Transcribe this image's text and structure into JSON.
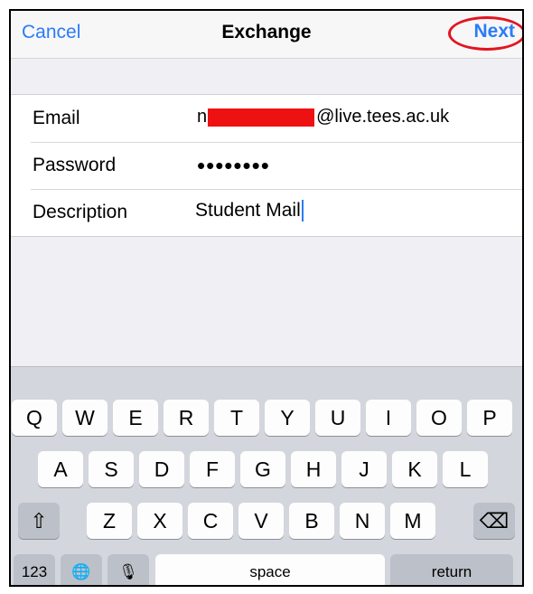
{
  "navbar": {
    "cancel_label": "Cancel",
    "title": "Exchange",
    "next_label": "Next"
  },
  "form": {
    "email": {
      "label": "Email",
      "value_prefix": "n",
      "value_suffix": "@live.tees.ac.uk"
    },
    "password": {
      "label": "Password",
      "value": "••••••••"
    },
    "description": {
      "label": "Description",
      "value": "Student Mail"
    }
  },
  "keyboard": {
    "row1": [
      "Q",
      "W",
      "E",
      "R",
      "T",
      "Y",
      "U",
      "I",
      "O",
      "P"
    ],
    "row2": [
      "A",
      "S",
      "D",
      "F",
      "G",
      "H",
      "J",
      "K",
      "L"
    ],
    "row3": [
      "Z",
      "X",
      "C",
      "V",
      "B",
      "N",
      "M"
    ],
    "shift_icon": "⇧",
    "delete_icon": "⌫",
    "numbers_label": "123",
    "globe_icon": "🌐",
    "mic_icon": "🎙",
    "space_label": "space",
    "return_label": "return"
  },
  "colors": {
    "accent": "#2a7cf6",
    "highlight_circle": "#e3141f",
    "redaction": "#ee1111"
  }
}
